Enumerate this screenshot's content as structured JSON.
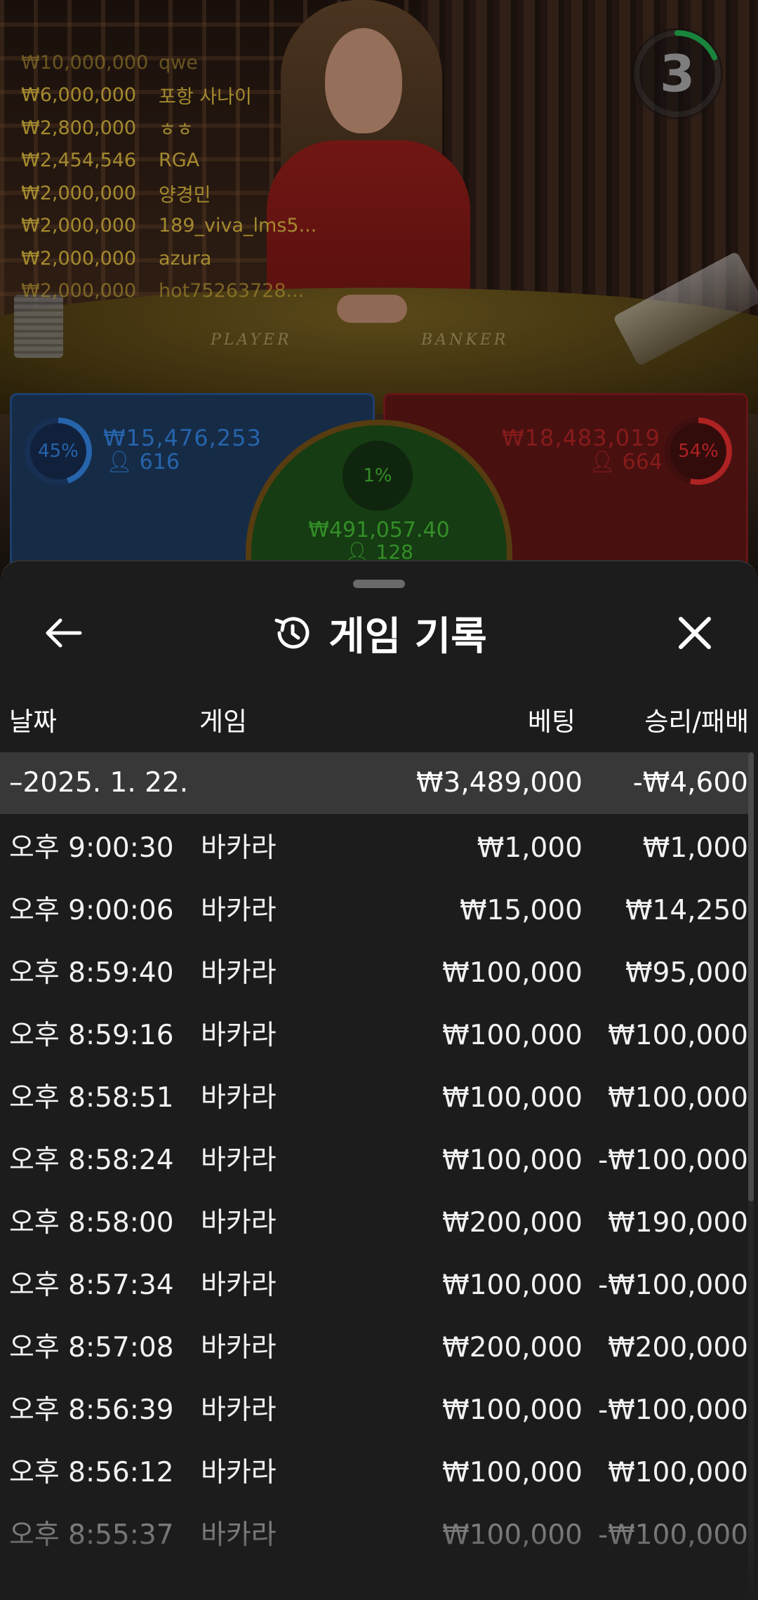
{
  "background": {
    "table_labels": {
      "player": "PLAYER",
      "banker": "BANKER"
    },
    "timer": {
      "value": "3",
      "color": "#1fa34a"
    },
    "winners": [
      {
        "amount": "₩10,000,000",
        "name": "qwe"
      },
      {
        "amount": "₩6,000,000",
        "name": "포항 사나이"
      },
      {
        "amount": "₩2,800,000",
        "name": "ㅎㅎ"
      },
      {
        "amount": "₩2,454,546",
        "name": "RGA"
      },
      {
        "amount": "₩2,000,000",
        "name": "양경민"
      },
      {
        "amount": "₩2,000,000",
        "name": "189_viva_lms5..."
      },
      {
        "amount": "₩2,000,000",
        "name": "azura"
      },
      {
        "amount": "₩2,000,000",
        "name": "hot75263728..."
      }
    ],
    "player": {
      "percent": "45%",
      "percent_value": 45,
      "amount": "₩15,476,253",
      "count": "616",
      "color": "#2f7ad1"
    },
    "banker": {
      "percent": "54%",
      "percent_value": 54,
      "amount": "₩18,483,019",
      "count": "664",
      "color": "#d42a2a"
    },
    "tie": {
      "percent": "1%",
      "percent_value": 1,
      "amount": "₩491,057.40",
      "count": "128",
      "color": "#3fae30"
    }
  },
  "sheet": {
    "title": "게임 기록",
    "icons": {
      "back": "arrow-left-icon",
      "history": "history-icon",
      "close": "close-icon"
    },
    "columns": {
      "date": "날짜",
      "game": "게임",
      "bet": "베팅",
      "result": "승리/패배"
    },
    "summary": {
      "date": "–2025. 1. 22.",
      "bet": "₩3,489,000",
      "result": "-₩4,600"
    },
    "rows": [
      {
        "time": "오후 9:00:30",
        "game": "바카라",
        "bet": "₩1,000",
        "result": "₩1,000"
      },
      {
        "time": "오후 9:00:06",
        "game": "바카라",
        "bet": "₩15,000",
        "result": "₩14,250"
      },
      {
        "time": "오후 8:59:40",
        "game": "바카라",
        "bet": "₩100,000",
        "result": "₩95,000"
      },
      {
        "time": "오후 8:59:16",
        "game": "바카라",
        "bet": "₩100,000",
        "result": "₩100,000"
      },
      {
        "time": "오후 8:58:51",
        "game": "바카라",
        "bet": "₩100,000",
        "result": "₩100,000"
      },
      {
        "time": "오후 8:58:24",
        "game": "바카라",
        "bet": "₩100,000",
        "result": "-₩100,000"
      },
      {
        "time": "오후 8:58:00",
        "game": "바카라",
        "bet": "₩200,000",
        "result": "₩190,000"
      },
      {
        "time": "오후 8:57:34",
        "game": "바카라",
        "bet": "₩100,000",
        "result": "-₩100,000"
      },
      {
        "time": "오후 8:57:08",
        "game": "바카라",
        "bet": "₩200,000",
        "result": "₩200,000"
      },
      {
        "time": "오후 8:56:39",
        "game": "바카라",
        "bet": "₩100,000",
        "result": "-₩100,000"
      },
      {
        "time": "오후 8:56:12",
        "game": "바카라",
        "bet": "₩100,000",
        "result": "₩100,000"
      },
      {
        "time": "오후 8:55:37",
        "game": "바카라",
        "bet": "₩100,000",
        "result": "-₩100,000"
      }
    ]
  }
}
